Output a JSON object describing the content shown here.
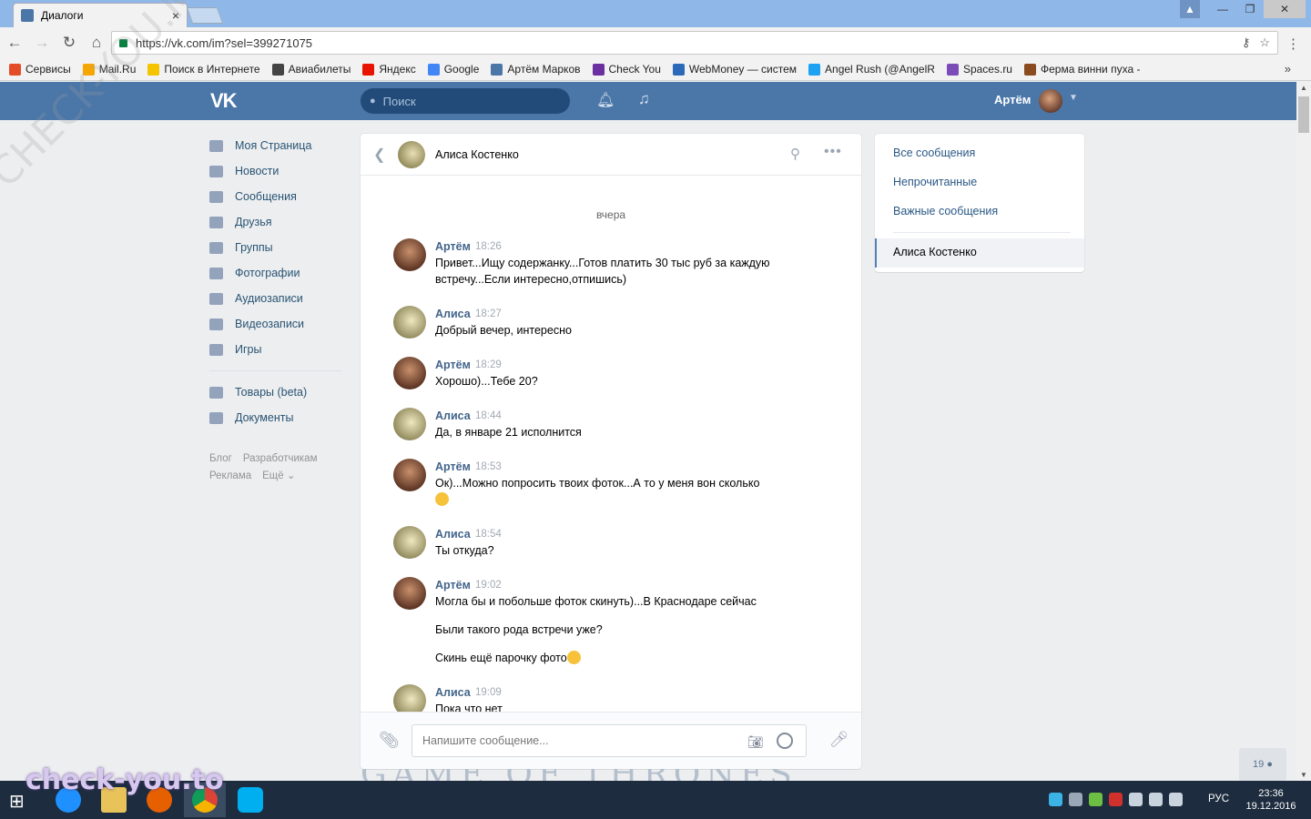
{
  "browser": {
    "tab_title": "Диалоги",
    "tab_close": "×",
    "url": "https://vk.com/im?sel=399271075",
    "window_buttons": [
      "—",
      "❐",
      "✕"
    ],
    "bookmarks": [
      {
        "label": "Сервисы",
        "color": "#e34c26"
      },
      {
        "label": "Mail.Ru",
        "color": "#f7a600"
      },
      {
        "label": "Поиск в Интернете",
        "color": "#f5c400"
      },
      {
        "label": "Авиабилеты",
        "color": "#444444"
      },
      {
        "label": "Яндекс",
        "color": "#e61400"
      },
      {
        "label": "Google",
        "color": "#4285f4"
      },
      {
        "label": "Артём Марков",
        "color": "#4a76a8"
      },
      {
        "label": "Check You",
        "color": "#6b2fa0"
      },
      {
        "label": "WebMoney — систем",
        "color": "#2a6ab8"
      },
      {
        "label": "Angel Rush (@AngelR",
        "color": "#1da1f2"
      },
      {
        "label": "Spaces.ru",
        "color": "#7b4bb7"
      },
      {
        "label": "Ферма винни пуха -",
        "color": "#8a4b1f"
      }
    ],
    "bookmarks_more": "»"
  },
  "vk_header": {
    "logo": "VK",
    "search_placeholder": "Поиск",
    "user_name": "Артём",
    "colors": {
      "header_bg": "#4a76a8",
      "search_bg": "#224b7a"
    }
  },
  "left_menu": {
    "items": [
      "Моя Страница",
      "Новости",
      "Сообщения",
      "Друзья",
      "Группы",
      "Фотографии",
      "Аудиозаписи",
      "Видеозаписи",
      "Игры"
    ],
    "extra_items": [
      "Товары (beta)",
      "Документы"
    ],
    "footer": {
      "blog": "Блог",
      "developers": "Разработчикам",
      "ads": "Реклама",
      "more": "Ещё ⌄"
    }
  },
  "chat": {
    "contact_name": "Алиса Костенко",
    "day_label": "вчера",
    "messages": [
      {
        "author": "Артём",
        "time": "18:26",
        "lines": [
          "Привет...Ищу содержанку...Готов платить 30 тыс руб за каждую встречу...Если интересно,отпишись)"
        ]
      },
      {
        "author": "Алиса",
        "time": "18:27",
        "lines": [
          "Добрый вечер, интересно"
        ]
      },
      {
        "author": "Артём",
        "time": "18:29",
        "lines": [
          "Хорошо)...Тебе 20?"
        ]
      },
      {
        "author": "Алиса",
        "time": "18:44",
        "lines": [
          "Да, в январе 21 исполнится"
        ]
      },
      {
        "author": "Артём",
        "time": "18:53",
        "lines": [
          "Ок)...Можно попросить твоих фоток...А то у меня вон сколько"
        ]
      },
      {
        "author": "Алиса",
        "time": "18:54",
        "lines": [
          "Ты откуда?"
        ]
      },
      {
        "author": "Артём",
        "time": "19:02",
        "lines": [
          "Могла бы и побольше фоток скинуть)...В Краснодаре сейчас",
          "Были такого рода встречи уже?",
          "Скинь ещё парочку фото"
        ]
      },
      {
        "author": "Алиса",
        "time": "19:09",
        "lines": [
          "Пока что нет"
        ]
      }
    ],
    "composer_placeholder": "Напишите сообщение..."
  },
  "right_panel": {
    "filters": [
      "Все сообщения",
      "Непрочитанные",
      "Важные сообщения"
    ],
    "active_dialog": "Алиса Костенко"
  },
  "online_count": "19",
  "background_title": "GAME OF THRONES",
  "taskbar": {
    "lang": "РУС",
    "time": "23:36",
    "date": "19.12.2016"
  },
  "watermark": {
    "text": "check-you.to",
    "diagonal": "CHECK-YOU.ME"
  }
}
